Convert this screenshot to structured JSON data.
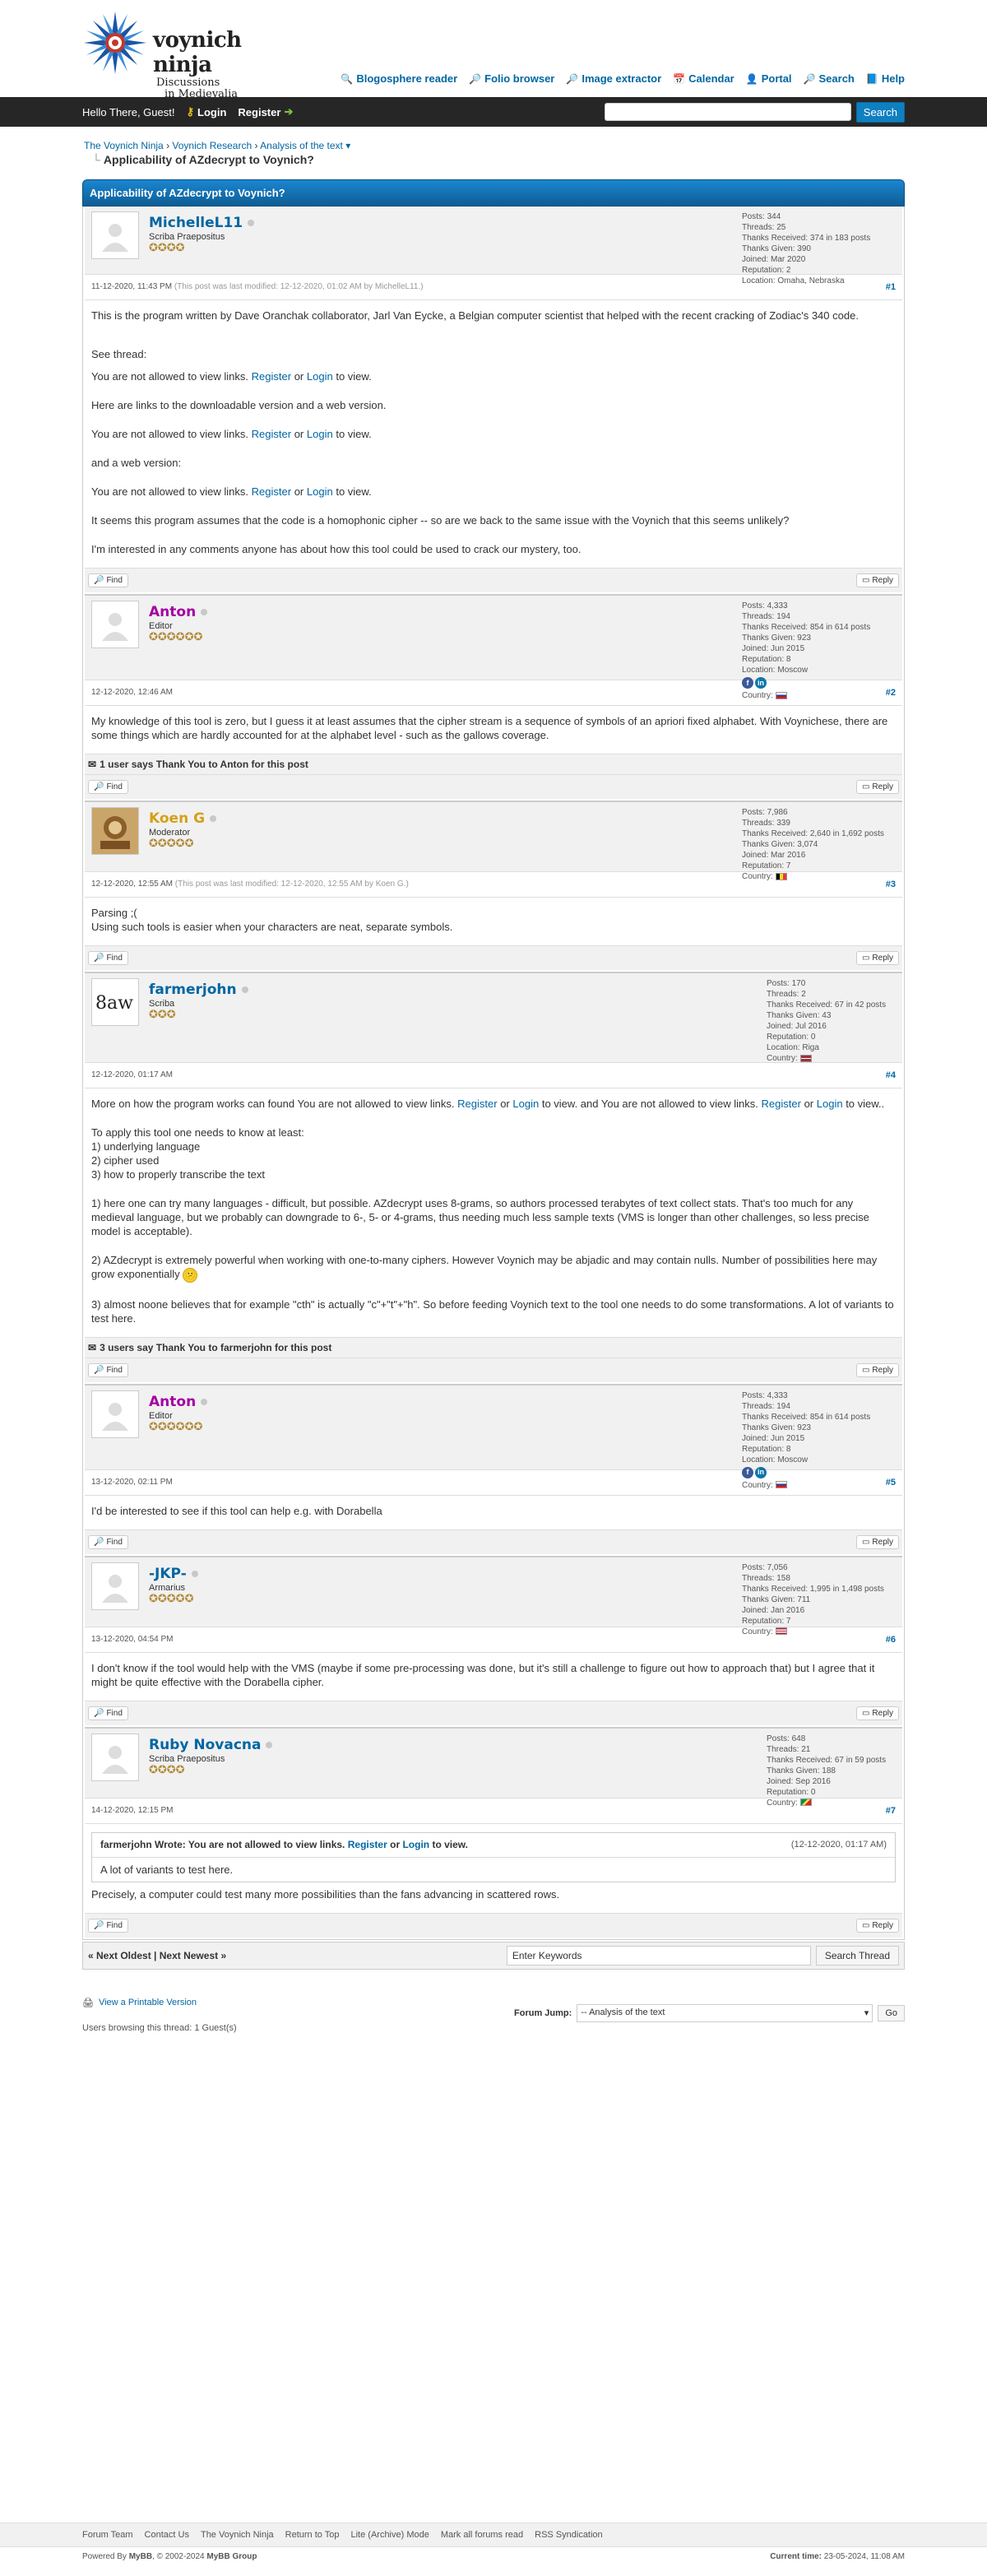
{
  "site": {
    "logo_title": "voynich ninja",
    "logo_sub1": "Discussions",
    "logo_sub2": "in Medievalia",
    "menu": [
      {
        "label": "Blogosphere reader",
        "icon": "reader-icon"
      },
      {
        "label": "Folio browser",
        "icon": "search-icon"
      },
      {
        "label": "Image extractor",
        "icon": "image-icon"
      },
      {
        "label": "Calendar",
        "icon": "calendar-icon"
      },
      {
        "label": "Portal",
        "icon": "user-icon"
      },
      {
        "label": "Search",
        "icon": "search-icon"
      },
      {
        "label": "Help",
        "icon": "help-icon"
      }
    ]
  },
  "panel": {
    "hello": "Hello There, Guest!",
    "login": "Login",
    "register": "Register",
    "search_button": "Search"
  },
  "breadcrumb": {
    "l1": "The Voynich Ninja",
    "l2": "Voynich Research",
    "l3": "Analysis of the text",
    "active": "Applicability of AZdecrypt to Voynich?"
  },
  "thread_title": "Applicability of AZdecrypt to Voynich?",
  "labels": {
    "find": "Find",
    "reply": "Reply"
  },
  "posts": [
    {
      "user": "MichelleL11",
      "title": "Scriba Praepositus",
      "stars": "✪✪✪✪",
      "color": "#0066a2",
      "stats": [
        "Posts: 344",
        "Threads: 25",
        "Thanks Received: 374 in 183 posts",
        "Thanks Given: 390",
        "Joined: Mar 2020",
        "Reputation: 2",
        "Location: Omaha, Nebraska"
      ],
      "date": "11-12-2020, 11:43 PM",
      "edited": "(This post was last modified: 12-12-2020, 01:02 AM by MichelleL11.)",
      "num": "#1"
    },
    {
      "user": "Anton",
      "title": "Editor",
      "stars": "✪✪✪✪✪✪",
      "color": "#a300a3",
      "stats": [
        "Posts: 4,333",
        "Threads: 194",
        "Thanks Received: 854 in 614 posts",
        "Thanks Given: 923",
        "Joined: Jun 2015",
        "Reputation: 8",
        "Location: Moscow"
      ],
      "country": "Country:",
      "date": "12-12-2020, 12:46 AM",
      "edited": "",
      "num": "#2",
      "thanks": "1 user says Thank You to Anton for this post",
      "body": "My knowledge of this tool is zero, but I guess it at least assumes that the cipher stream is a sequence of symbols of an apriori fixed alphabet. With Voynichese, there are some things which are hardly accounted for at the alphabet level - such as the gallows coverage."
    },
    {
      "user": "Koen G",
      "title": "Moderator",
      "stars": "✪✪✪✪✪",
      "color": "#d4a017",
      "stats": [
        "Posts: 7,986",
        "Threads: 339",
        "Thanks Received: 2,640 in 1,692 posts",
        "Thanks Given: 3,074",
        "Joined: Mar 2016",
        "Reputation: 7"
      ],
      "country": "Country:",
      "date": "12-12-2020, 12:55 AM",
      "edited": "(This post was last modified: 12-12-2020, 12:55 AM by Koen G.)",
      "num": "#3",
      "body1": "Parsing ;(",
      "body2": "Using such tools is easier when your characters are neat, separate symbols."
    },
    {
      "user": "farmerjohn",
      "title": "Scriba",
      "stars": "✪✪✪",
      "color": "#0066a2",
      "stats": [
        "Posts: 170",
        "Threads: 2",
        "Thanks Received: 67 in 42 posts",
        "Thanks Given: 43",
        "Joined: Jul 2016",
        "Reputation: 0",
        "Location: Riga"
      ],
      "country": "Country:",
      "date": "12-12-2020, 01:17 AM",
      "edited": "",
      "num": "#4",
      "thanks": "3 users say Thank You to farmerjohn for this post"
    },
    {
      "user": "Anton",
      "title": "Editor",
      "stars": "✪✪✪✪✪✪",
      "color": "#a300a3",
      "stats": [
        "Posts: 4,333",
        "Threads: 194",
        "Thanks Received: 854 in 614 posts",
        "Thanks Given: 923",
        "Joined: Jun 2015",
        "Reputation: 8",
        "Location: Moscow"
      ],
      "country": "Country:",
      "date": "13-12-2020, 02:11 PM",
      "edited": "",
      "num": "#5",
      "body": "I'd be interested to see if this tool can help e.g. with Dorabella"
    },
    {
      "user": "-JKP-",
      "title": "Armarius",
      "stars": "✪✪✪✪✪",
      "color": "#0066a2",
      "stats": [
        "Posts: 7,056",
        "Threads: 158",
        "Thanks Received: 1,995 in 1,498 posts",
        "Thanks Given: 711",
        "Joined: Jan 2016",
        "Reputation: 7"
      ],
      "country": "Country:",
      "date": "13-12-2020, 04:54 PM",
      "edited": "",
      "num": "#6",
      "body": "I don't know if the tool would help with the VMS (maybe if some pre-processing was done, but it's still a challenge to figure out how to approach that) but I agree that it might be quite effective with the Dorabella cipher."
    },
    {
      "user": "Ruby Novacna",
      "title": "Scriba Praepositus",
      "stars": "✪✪✪✪",
      "color": "#0066a2",
      "stats": [
        "Posts: 648",
        "Threads: 21",
        "Thanks Received: 67 in 59 posts",
        "Thanks Given: 188",
        "Joined: Sep 2016",
        "Reputation: 0"
      ],
      "country": "Country:",
      "date": "14-12-2020, 12:15 PM",
      "edited": "",
      "num": "#7",
      "quote_head": "farmerjohn Wrote: You are not allowed to view links.",
      "quote_reg": "Register",
      "quote_or": "or",
      "quote_login": "Login",
      "quote_to": "to view.",
      "quote_date": "(12-12-2020, 01:17 AM)",
      "quote_body": "A lot of variants to test here.",
      "body": "Precisely, a computer could test many more possibilities than the fans advancing in scattered rows."
    }
  ],
  "post1": {
    "p1": "This is the program written by Dave Oranchak collaborator, Jarl Van Eycke, a Belgian computer scientist that helped with the recent cracking of Zodiac's 340 code.",
    "p2": "See thread:",
    "links_notice": "You are not allowed to view links.",
    "register": "Register",
    "or": "or",
    "login": "Login",
    "to_view": "to view.",
    "p3": "Here are links to the downloadable version and a web version.",
    "p4": "and a web version:",
    "p5": "It seems this program assumes that the code is a homophonic cipher -- so are we back to the same issue with the Voynich that this seems unlikely?",
    "p6": "I'm interested in any comments anyone has about how this tool could be used to crack our mystery, too."
  },
  "post4": {
    "p1a": "More on how the program works can found You are not allowed to view links.",
    "register": "Register",
    "or": "or",
    "login": "Login",
    "p1b": "to view. and You are not allowed to view links.",
    "p1c": "to view..",
    "l1": "To apply this tool one needs to know at least:",
    "l2": "1) underlying language",
    "l3": "2) cipher used",
    "l4": "3) how to properly transcribe the text",
    "p2": "1) here one can try many languages - difficult, but possible. AZdecrypt uses 8-grams, so authors processed terabytes of text collect stats. That's too much for any medieval language, but we probably can downgrade to 6-, 5- or 4-grams, thus needing much less sample texts (VMS is longer than other challenges, so less precise model is acceptable).",
    "p3": "2) AZdecrypt is extremely powerful when working with one-to-many ciphers. However Voynich may be abjadic and may contain nulls. Number of possibilities here may grow exponentially",
    "p4": "3) almost noone believes that for example \"cth\" is actually \"c\"+\"t\"+\"h\". So before feeding Voynich text to the tool one needs to do some transformations. A lot of variants to test here."
  },
  "bottom": {
    "next_oldest": "« Next Oldest",
    "sep": "|",
    "next_newest": "Next Newest »",
    "keywords": "Enter Keywords",
    "search_thread": "Search Thread"
  },
  "lower": {
    "printable": "View a Printable Version",
    "forum_jump": "Forum Jump:",
    "jump_value": "-- Analysis of the text",
    "go": "Go",
    "browsing": "Users browsing this thread: 1 Guest(s)"
  },
  "footer": {
    "links": [
      "Forum Team",
      "Contact Us",
      "The Voynich Ninja",
      "Return to Top",
      "Lite (Archive) Mode",
      "Mark all forums read",
      "RSS Syndication"
    ],
    "powered": "Powered By",
    "mybb": "MyBB",
    "copyright": ", © 2002-2024",
    "group": "MyBB Group",
    "time_label": "Current time:",
    "time": "23-05-2024, 11:08 AM"
  }
}
